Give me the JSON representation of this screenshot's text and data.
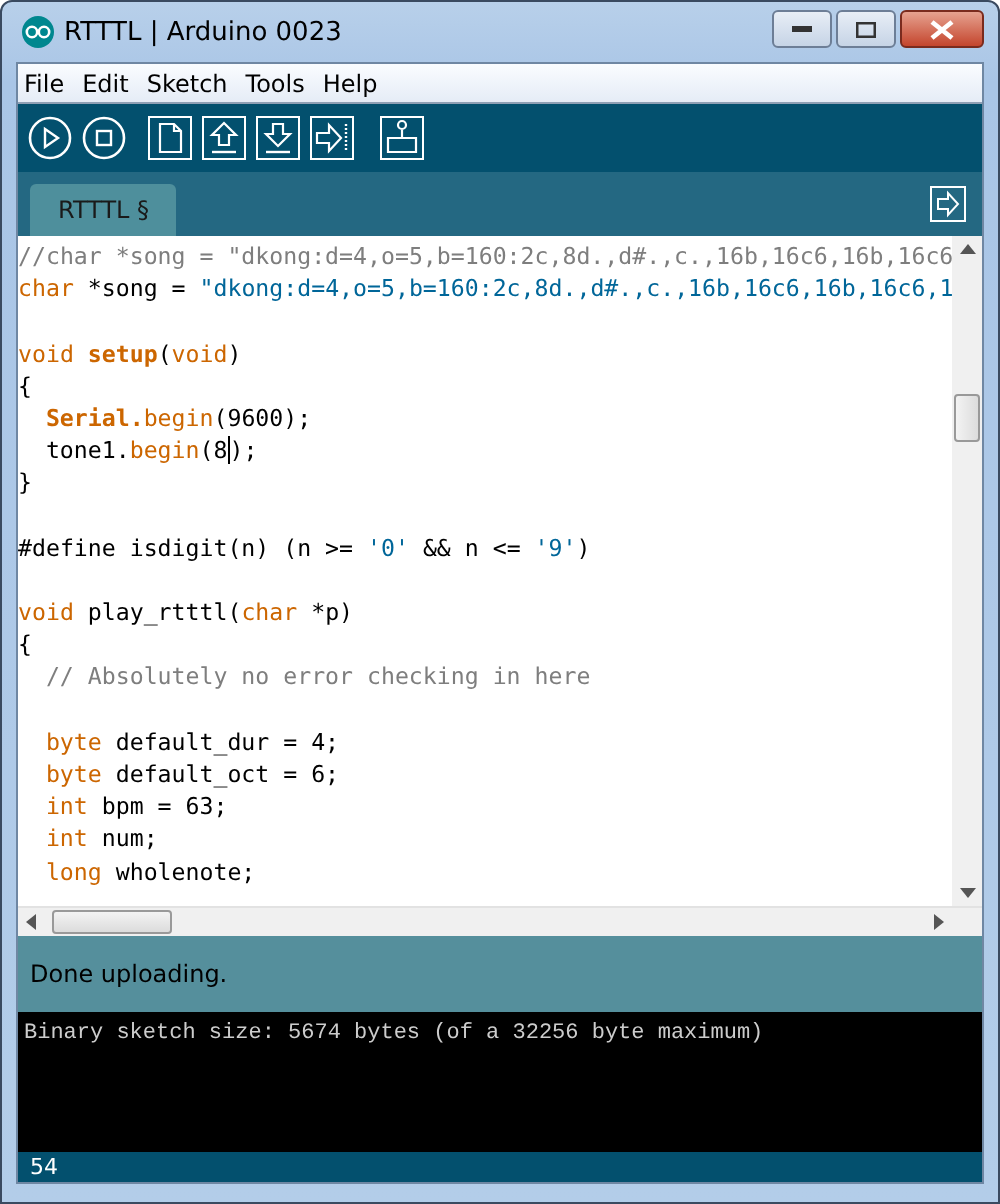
{
  "window": {
    "title": "RTTTL | Arduino 0023"
  },
  "menu": [
    "File",
    "Edit",
    "Sketch",
    "Tools",
    "Help"
  ],
  "toolbar": [
    {
      "kind": "play"
    },
    {
      "kind": "stop"
    },
    {
      "kind": "new"
    },
    {
      "kind": "open"
    },
    {
      "kind": "save"
    },
    {
      "kind": "upload"
    },
    {
      "kind": "monitor"
    }
  ],
  "tabs": [
    {
      "label": "RTTTL §",
      "selected": true
    }
  ],
  "editor": {
    "lines": [
      {
        "kind": "code",
        "indented": false,
        "tokens": [
          {
            "kind": "comment",
            "text": "//char *song = \"dkong:d=4,o=5,b=160:2c,8d.,d#.,c.,16b,16c6,16b,16c6"
          }
        ]
      },
      {
        "kind": "code",
        "indented": false,
        "tokens": [
          {
            "kind": "keyword",
            "text": "char"
          },
          {
            "kind": "plain",
            "text": " *song = "
          },
          {
            "kind": "string",
            "text": "\"dkong:d=4,o=5,b=160:2c,8d.,d#.,c.,16b,16c6,16b,16c6,1"
          }
        ]
      },
      {
        "kind": "blank"
      },
      {
        "kind": "code",
        "indented": false,
        "tokens": [
          {
            "kind": "keyword",
            "text": "void "
          },
          {
            "kind": "bold",
            "text": "setup"
          },
          {
            "kind": "plain",
            "text": "("
          },
          {
            "kind": "keyword",
            "text": "void"
          },
          {
            "kind": "plain",
            "text": ")"
          }
        ]
      },
      {
        "kind": "code",
        "indented": false,
        "tokens": [
          {
            "kind": "plain",
            "text": "{"
          }
        ]
      },
      {
        "kind": "code",
        "indented": true,
        "tokens": [
          {
            "kind": "bold",
            "text": "Serial."
          },
          {
            "kind": "keyword",
            "text": "begin"
          },
          {
            "kind": "plain",
            "text": "(9600);"
          }
        ]
      },
      {
        "kind": "code",
        "indented": true,
        "tokens": [
          {
            "kind": "plain",
            "text": "tone1."
          },
          {
            "kind": "keyword",
            "text": "begin"
          },
          {
            "kind": "plain",
            "text": "(8"
          },
          {
            "kind": "plain",
            "text": ");",
            "caret_before": true
          }
        ]
      },
      {
        "kind": "code",
        "indented": false,
        "tokens": [
          {
            "kind": "plain",
            "text": "}"
          }
        ]
      },
      {
        "kind": "blank"
      },
      {
        "kind": "code",
        "indented": false,
        "tokens": [
          {
            "kind": "plain",
            "text": "#define isdigit(n) (n >= "
          },
          {
            "kind": "string",
            "text": "'0'"
          },
          {
            "kind": "plain",
            "text": " && n <= "
          },
          {
            "kind": "string",
            "text": "'9'"
          },
          {
            "kind": "plain",
            "text": ")"
          }
        ]
      },
      {
        "kind": "blank"
      },
      {
        "kind": "code",
        "indented": false,
        "tokens": [
          {
            "kind": "keyword",
            "text": "void"
          },
          {
            "kind": "plain",
            "text": " play_rtttl("
          },
          {
            "kind": "keyword",
            "text": "char"
          },
          {
            "kind": "plain",
            "text": " *p)"
          }
        ]
      },
      {
        "kind": "code",
        "indented": false,
        "tokens": [
          {
            "kind": "plain",
            "text": "{"
          }
        ]
      },
      {
        "kind": "code",
        "indented": true,
        "tokens": [
          {
            "kind": "comment",
            "text": "// Absolutely no error checking in here"
          }
        ]
      },
      {
        "kind": "blank"
      },
      {
        "kind": "code",
        "indented": true,
        "tokens": [
          {
            "kind": "keyword",
            "text": "byte"
          },
          {
            "kind": "plain",
            "text": " default_dur = 4;"
          }
        ]
      },
      {
        "kind": "code",
        "indented": true,
        "tokens": [
          {
            "kind": "keyword",
            "text": "byte"
          },
          {
            "kind": "plain",
            "text": " default_oct = 6;"
          }
        ]
      },
      {
        "kind": "code",
        "indented": true,
        "tokens": [
          {
            "kind": "keyword",
            "text": "int"
          },
          {
            "kind": "plain",
            "text": " bpm = 63;"
          }
        ]
      },
      {
        "kind": "code",
        "indented": true,
        "tokens": [
          {
            "kind": "keyword",
            "text": "int"
          },
          {
            "kind": "plain",
            "text": " num;"
          }
        ]
      },
      {
        "kind": "code",
        "indented": true,
        "tokens": [
          {
            "kind": "keyword",
            "text": "long"
          },
          {
            "kind": "plain",
            "text": " wholenote;"
          }
        ]
      }
    ]
  },
  "status": {
    "message": "Done uploading."
  },
  "console": {
    "lines": [
      "Binary sketch size: 5674 bytes (of a 32256 byte maximum)"
    ]
  },
  "footer": {
    "line": "54"
  }
}
